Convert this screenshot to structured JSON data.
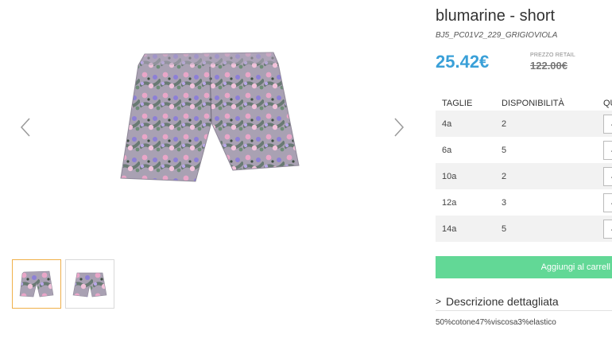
{
  "product": {
    "title": "blumarine - short",
    "sku": "BJ5_PC01V2_229_GRIGIOVIOLA",
    "price": "25.42€",
    "retail_label": "PREZZO RETAIL",
    "retail_price": "122.00€"
  },
  "gallery": {
    "prev_icon": "chevron-left-icon",
    "next_icon": "chevron-right-icon",
    "thumbnails": [
      "thumbnail-front",
      "thumbnail-back"
    ]
  },
  "sizes_table": {
    "headers": [
      "TAGLIE",
      "DISPONIBILITÀ",
      "QUA"
    ],
    "rows": [
      {
        "size": "4a",
        "availability": "2",
        "qty": "-"
      },
      {
        "size": "6a",
        "availability": "5",
        "qty": "-"
      },
      {
        "size": "10a",
        "availability": "2",
        "qty": "-"
      },
      {
        "size": "12a",
        "availability": "3",
        "qty": "-"
      },
      {
        "size": "14a",
        "availability": "5",
        "qty": "-"
      }
    ]
  },
  "actions": {
    "add_to_cart": "Aggiungi al carrell"
  },
  "description": {
    "toggle_icon": ">",
    "toggle_label": "Descrizione dettagliata",
    "material": "50%cotone47%viscosa3%elastico"
  },
  "colors": {
    "price": "#3aa0d8",
    "cart_button": "#62d896",
    "thumb_active_border": "#f0b04a"
  }
}
